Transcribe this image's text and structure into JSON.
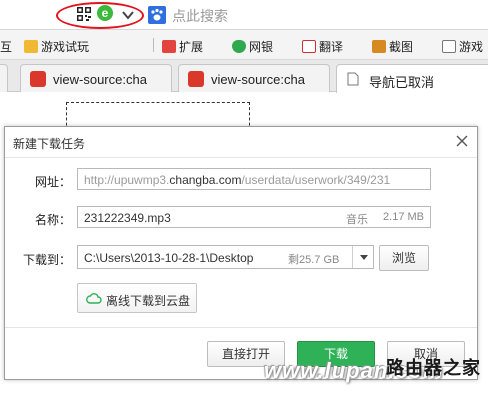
{
  "address_bar": {
    "search_placeholder": "点此搜索",
    "ie_glyph": "e"
  },
  "bookmarks": [
    {
      "label": "互",
      "icon": "partial-icon"
    },
    {
      "label": "游戏试玩",
      "icon": "folder-icon"
    },
    {
      "label": "扩展",
      "icon": "extensions-icon"
    },
    {
      "label": "网银",
      "icon": "shield-icon"
    },
    {
      "label": "翻译",
      "icon": "translate-icon"
    },
    {
      "label": "截图",
      "icon": "scissors-icon"
    },
    {
      "label": "游戏",
      "icon": "game-icon"
    }
  ],
  "tabs": [
    {
      "label": "view-source:cha",
      "active": false
    },
    {
      "label": "view-source:cha",
      "active": false
    },
    {
      "label": "导航已取消",
      "active": true
    }
  ],
  "dialog": {
    "title": "新建下载任务",
    "url_label": "网址：",
    "url_prefix": "http://upuwmp3.",
    "url_domain": "changba.com",
    "url_suffix": "/userdata/userwork/349/231",
    "name_label": "名称：",
    "filename": "231222349.mp3",
    "file_type": "音乐",
    "file_size": "2.17 MB",
    "save_label": "下载到：",
    "save_path": "C:\\Users\\2013-10-28-1\\Desktop",
    "free_space": "剩25.7 GB",
    "browse_label": "浏览",
    "cloud_label": "离线下载到云盘",
    "open_label": "直接打开",
    "download_label": "下载",
    "cancel_label": "取消"
  },
  "watermark": {
    "url_text": "www.lupan.com",
    "site_text": "路由器之家"
  },
  "colors": {
    "download_button": "#2fb257",
    "highlight_oval": "#e0141e",
    "ie_icon": "#3cb83c"
  }
}
